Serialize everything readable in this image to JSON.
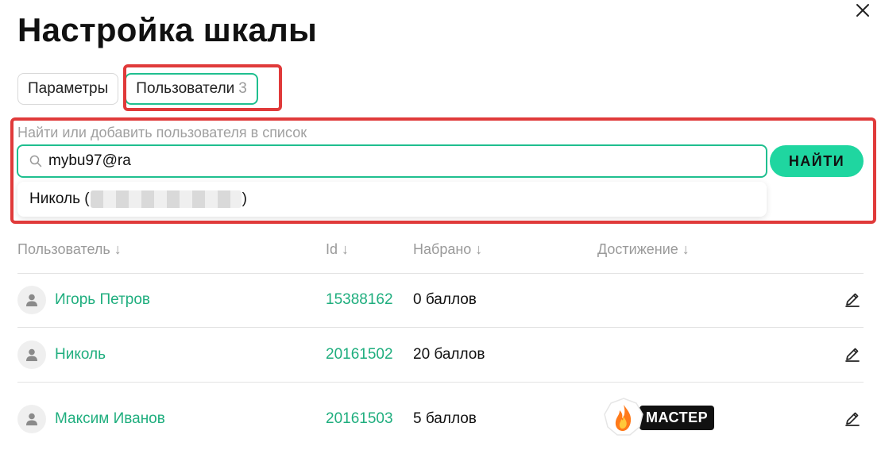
{
  "dialog": {
    "title": "Настройка шкалы"
  },
  "tabs": [
    {
      "label": "Параметры",
      "count": ""
    },
    {
      "label": "Пользователи",
      "count": "3"
    }
  ],
  "search": {
    "label": "Найти или добавить пользователя в список",
    "value": "mybu97@ra",
    "button_label": "НАЙТИ",
    "suggestion": {
      "prefix": "Николь (",
      "suffix": ")"
    }
  },
  "table": {
    "columns": [
      "Пользователь ↓",
      "Id ↓",
      "Набрано ↓",
      "Достижение ↓"
    ],
    "rows": [
      {
        "name": "Игорь Петров",
        "id": "15388162",
        "score": "0 баллов",
        "achievement": ""
      },
      {
        "name": "Николь",
        "id": "20161502",
        "score": "20 баллов",
        "achievement": ""
      },
      {
        "name": "Максим Иванов",
        "id": "20161503",
        "score": "5 баллов",
        "achievement": "МАСТЕР"
      }
    ]
  },
  "colors": {
    "accent": "#1fbf8f",
    "button": "#1fd6a0",
    "highlight": "#e03a3a",
    "link": "#1fae7e"
  }
}
